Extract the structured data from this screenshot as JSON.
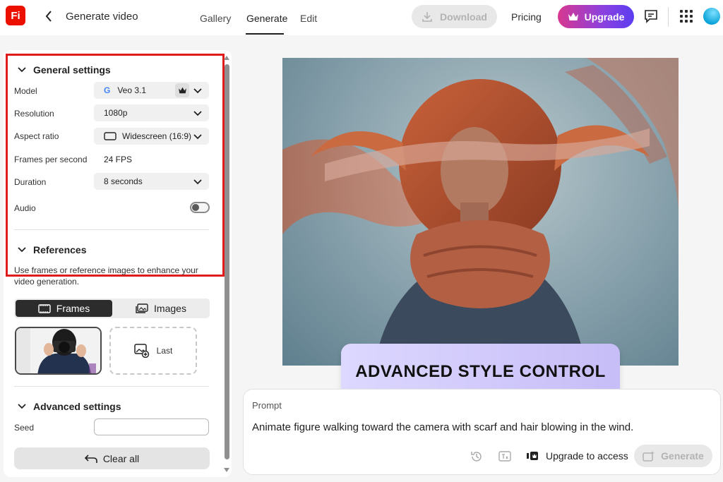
{
  "app": {
    "logo_text": "Fi",
    "title": "Generate video"
  },
  "nav": {
    "tabs": [
      "Gallery",
      "Generate",
      "Edit"
    ],
    "active": "Generate"
  },
  "topbar": {
    "download_label": "Download",
    "pricing_label": "Pricing",
    "upgrade_label": "Upgrade"
  },
  "general": {
    "heading": "General settings",
    "model_label": "Model",
    "model_value": "Veo 3.1",
    "resolution_label": "Resolution",
    "resolution_value": "1080p",
    "aspect_label": "Aspect ratio",
    "aspect_value": "Widescreen (16:9)",
    "fps_label": "Frames per second",
    "fps_value": "24 FPS",
    "duration_label": "Duration",
    "duration_value": "8 seconds",
    "audio_label": "Audio",
    "audio_on": false
  },
  "references": {
    "heading": "References",
    "description": "Use frames or reference images to enhance your video generation.",
    "tab_frames": "Frames",
    "tab_images": "Images",
    "last_label": "Last"
  },
  "advanced": {
    "heading": "Advanced settings",
    "seed_label": "Seed",
    "seed_value": ""
  },
  "clear_label": "Clear all",
  "badge_text": "ADVANCED STYLE CONTROL",
  "prompt": {
    "label": "Prompt",
    "text": "Animate figure walking toward the camera with scarf and hair blowing in the wind.",
    "upgrade_access_label": "Upgrade to access",
    "generate_label": "Generate"
  },
  "colors": {
    "brand_red": "#eb1000",
    "highlight_frame": "#e01b1b",
    "upgrade_gradient_start": "#d7388f",
    "upgrade_gradient_end": "#5b3df0",
    "badge_bg": "#d3ccfb"
  }
}
